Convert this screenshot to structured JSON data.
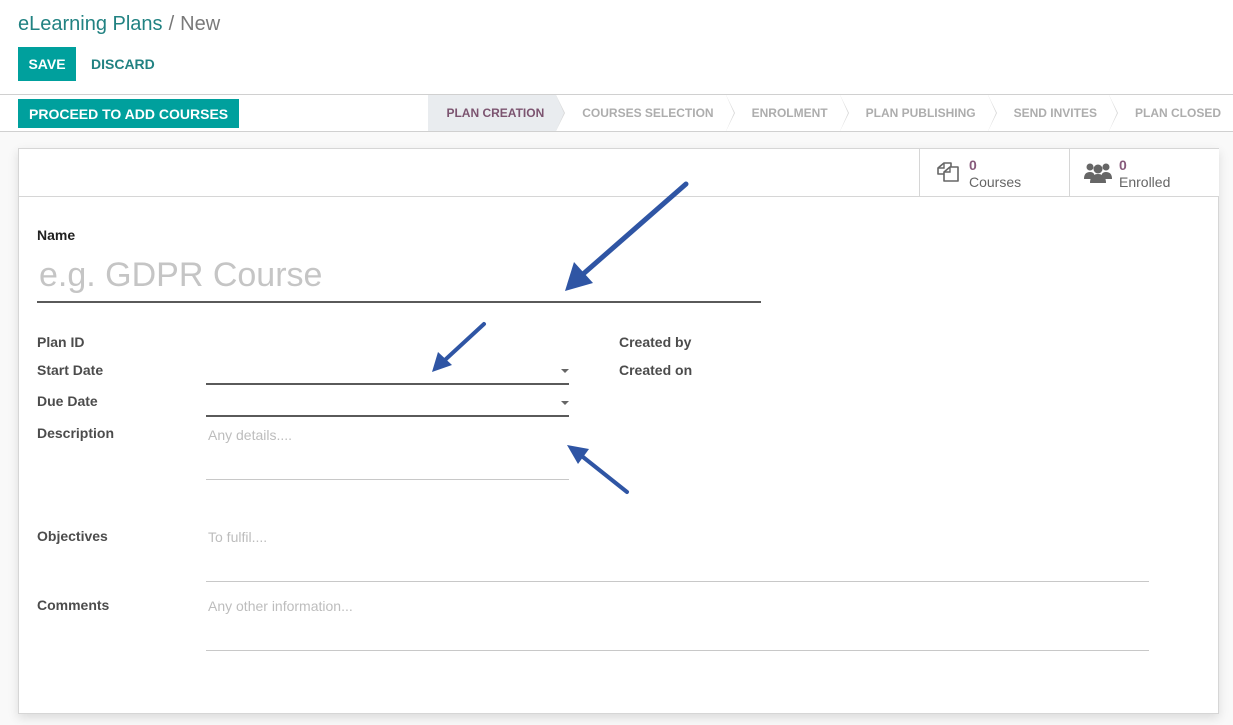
{
  "breadcrumb": {
    "parent": "eLearning Plans",
    "separator": "/",
    "current": "New"
  },
  "toolbar": {
    "save_label": "SAVE",
    "discard_label": "DISCARD"
  },
  "statusbar": {
    "proceed_label": "PROCEED TO ADD COURSES",
    "stages": [
      {
        "label": "PLAN CREATION",
        "active": true
      },
      {
        "label": "COURSES SELECTION",
        "active": false
      },
      {
        "label": "ENROLMENT",
        "active": false
      },
      {
        "label": "PLAN PUBLISHING",
        "active": false
      },
      {
        "label": "SEND INVITES",
        "active": false
      },
      {
        "label": "PLAN CLOSED",
        "active": false
      }
    ]
  },
  "stat_buttons": {
    "courses": {
      "icon": "copy-icon",
      "value": "0",
      "label": "Courses"
    },
    "enrolled": {
      "icon": "users-icon",
      "value": "0",
      "label": "Enrolled"
    }
  },
  "form": {
    "name_label": "Name",
    "name_placeholder": "e.g. GDPR Course",
    "plan_id_label": "Plan ID",
    "start_date_label": "Start Date",
    "due_date_label": "Due Date",
    "description_label": "Description",
    "description_placeholder": "Any details....",
    "created_by_label": "Created by",
    "created_on_label": "Created on",
    "objectives_label": "Objectives",
    "objectives_placeholder": "To fulfil....",
    "comments_label": "Comments",
    "comments_placeholder": "Any other information..."
  },
  "colors": {
    "primary": "#00a09d",
    "link": "#218282",
    "active_stage_text": "#7c5470",
    "stat_value": "#875a7b",
    "annotation_arrow": "#2f55a4"
  }
}
